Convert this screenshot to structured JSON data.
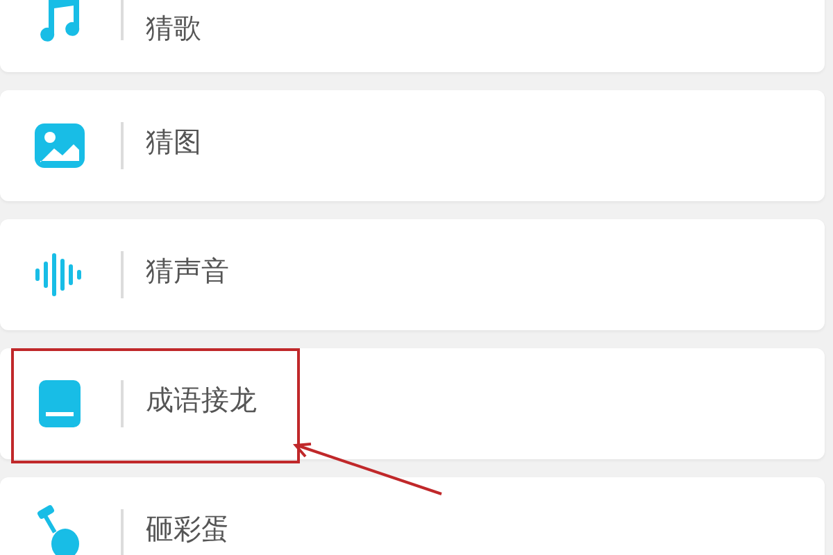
{
  "items": [
    {
      "kind": "music",
      "label": "猜歌",
      "highlighted": false
    },
    {
      "kind": "image",
      "label": "猜图",
      "highlighted": false
    },
    {
      "kind": "sound",
      "label": "猜声音",
      "highlighted": false
    },
    {
      "kind": "book",
      "label": "成语接龙",
      "highlighted": true
    },
    {
      "kind": "egg",
      "label": "砸彩蛋",
      "highlighted": false
    }
  ]
}
